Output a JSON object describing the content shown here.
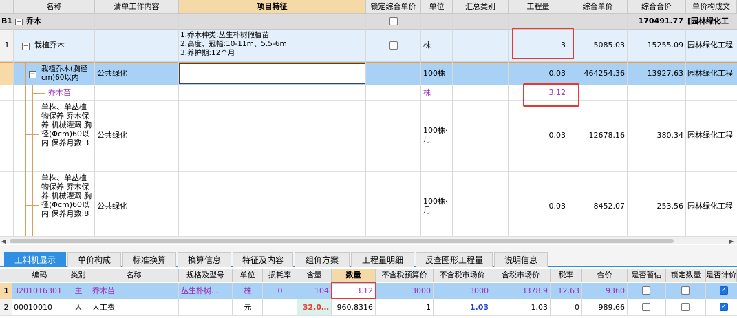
{
  "top_headers": [
    "名称",
    "清单工作内容",
    "项目特征",
    "锁定综合单价",
    "单位",
    "汇总类别",
    "工程量",
    "综合单价",
    "综合合价",
    "单价构成文"
  ],
  "b1_row": {
    "index": "B1",
    "expander": "−",
    "name": "乔木",
    "total": "170491.77",
    "tmpl": "[园林绿化工"
  },
  "row1": {
    "index": "1",
    "expander": "−",
    "name": "栽植乔木",
    "features": [
      "1.乔木种类:丛生朴树假植苗",
      "2.高度、冠幅:10-11m、5.5-6m",
      "3.养护期:12个月"
    ],
    "unit": "株",
    "qty": "3",
    "unit_price": "5085.03",
    "total": "15255.09",
    "tmpl": "园林绿化工程"
  },
  "row2": {
    "expander": "−",
    "name": "栽植乔木(胸径cm)60以内",
    "work": "公共绿化",
    "unit": "100株",
    "qty": "0.03",
    "unit_price": "464254.36",
    "total": "13927.63",
    "tmpl": "园林绿化工程"
  },
  "row3": {
    "name": "乔木苗",
    "unit": "株",
    "qty": "3.12"
  },
  "row4": {
    "name": "单株、单丛植物保养 乔木保养 机械灌溉 胸径(Φcm)60以内 保养月数:3",
    "work": "公共绿化",
    "unit": "100株·月",
    "qty": "0.03",
    "unit_price": "12678.16",
    "total": "380.34",
    "tmpl": "园林绿化工程"
  },
  "row5": {
    "name": "单株、单丛植物保养 乔木保养 机械灌溉 胸径(Φcm)60以内 保养月数:8",
    "work": "公共绿化",
    "unit": "100株·月",
    "qty": "0.03",
    "unit_price": "8452.07",
    "total": "253.56",
    "tmpl": "园林绿化工程"
  },
  "tabs": [
    "工料机显示",
    "单价构成",
    "标准换算",
    "换算信息",
    "特征及内容",
    "组价方案",
    "工程量明细",
    "反查图形工程量",
    "说明信息"
  ],
  "bottom_headers": [
    "编码",
    "类别",
    "名称",
    "规格及型号",
    "单位",
    "损耗率",
    "含量",
    "数量",
    "不含税预算价",
    "不含税市场价",
    "含税市场价",
    "税率",
    "合价",
    "是否暂估",
    "锁定数量",
    "是否计价"
  ],
  "bottom_rows": [
    {
      "index": "1",
      "code": "3201016301",
      "type": "主",
      "name": "乔木苗",
      "spec": "丛生朴树…",
      "unit": "株",
      "loss": "0",
      "content": "104",
      "qty": "3.12",
      "budget": "3000",
      "market": "3000",
      "tax_market": "3378.9",
      "rate": "12.63",
      "total": "9360"
    },
    {
      "index": "2",
      "code": "00010010",
      "type": "人",
      "name": "人工费",
      "spec": "",
      "unit": "元",
      "loss": "",
      "content": "32,0…",
      "qty": "960.8316",
      "budget": "1",
      "market": "1.03",
      "tax_market": "1.03",
      "rate": "0",
      "total": "989.66"
    }
  ]
}
